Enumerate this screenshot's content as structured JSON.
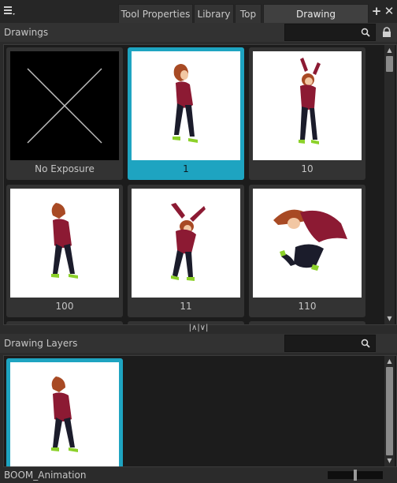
{
  "tabs": [
    "Tool Properties",
    "Library",
    "Top",
    "Drawing Substitutions"
  ],
  "active_tab": "Drawing Substitutions",
  "drawings": {
    "title": "Drawings",
    "search_placeholder": "",
    "items": [
      {
        "label": "No Exposure",
        "selected": false
      },
      {
        "label": "1",
        "selected": true
      },
      {
        "label": "10",
        "selected": false
      },
      {
        "label": "100",
        "selected": false
      },
      {
        "label": "11",
        "selected": false
      },
      {
        "label": "110",
        "selected": false
      }
    ]
  },
  "drawing_layers": {
    "title": "Drawing Layers",
    "search_placeholder": ""
  },
  "footer": {
    "layer_name": "BOOM_Animation",
    "zoom_level": 0.5
  },
  "colors": {
    "selection": "#1ea4c1",
    "background": "#2b2b2b",
    "panel": "#1c1c1c"
  },
  "icons": [
    "menu-icon",
    "add-tab-icon",
    "close-tab-icon",
    "search-icon",
    "lock-icon",
    "splitter-arrows-icon"
  ]
}
